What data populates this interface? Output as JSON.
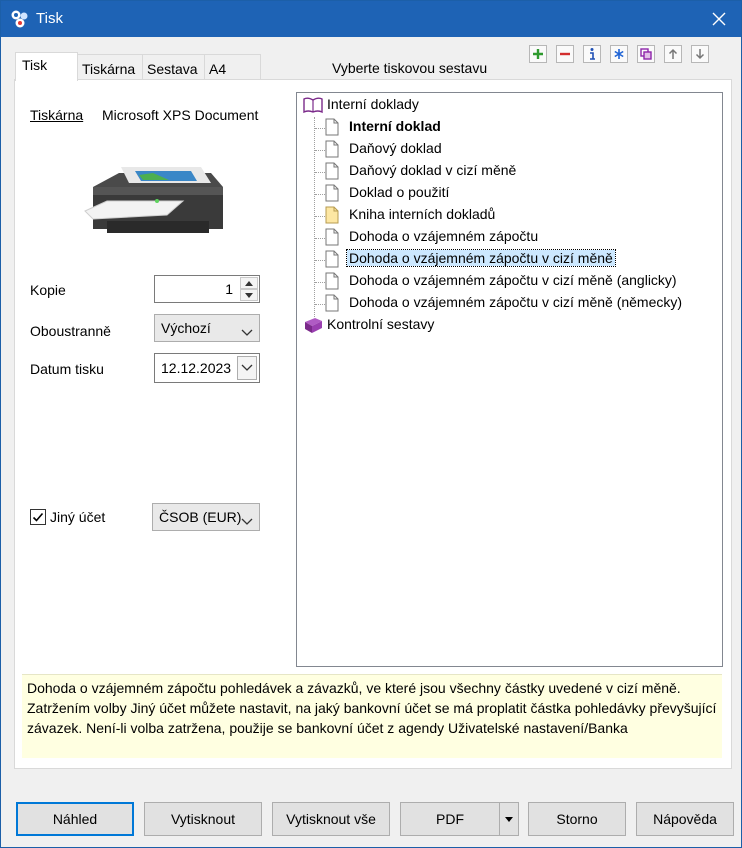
{
  "window": {
    "title": "Tisk"
  },
  "tabs": [
    "Tisk",
    "Tiskárna",
    "Sestava",
    "A4"
  ],
  "toolbar": {
    "label": "Vyberte tiskovou sestavu",
    "icons": [
      "add-icon",
      "remove-icon",
      "info-icon",
      "asterisk-icon",
      "copy-icon",
      "move-up-icon",
      "move-down-icon"
    ]
  },
  "printer": {
    "label": "Tiskárna",
    "name": "Microsoft XPS Document"
  },
  "copies": {
    "label": "Kopie",
    "value": "1"
  },
  "duplex": {
    "label": "Oboustranně",
    "value": "Výchozí"
  },
  "print_date": {
    "label": "Datum tisku",
    "value": "12.12.2023"
  },
  "other_account": {
    "label": "Jiný účet",
    "checked": true,
    "value": "ČSOB (EUR)"
  },
  "tree": {
    "groups": [
      {
        "label": "Interní doklady",
        "items": [
          {
            "label": "Interní doklad",
            "bold": true
          },
          {
            "label": "Daňový doklad"
          },
          {
            "label": "Daňový doklad v cizí měně"
          },
          {
            "label": "Doklad o použití"
          },
          {
            "label": "Kniha interních dokladů",
            "folder": true
          },
          {
            "label": "Dohoda o vzájemném zápočtu"
          },
          {
            "label": "Dohoda o vzájemném zápočtu v cizí měně",
            "selected": true
          },
          {
            "label": "Dohoda o vzájemném zápočtu v cizí měně (anglicky)"
          },
          {
            "label": "Dohoda o vzájemném zápočtu v cizí měně (německy)"
          }
        ]
      },
      {
        "label": "Kontrolní sestavy",
        "items": []
      }
    ]
  },
  "description": "Dohoda o vzájemném zápočtu pohledávek a závazků, ve které jsou všechny částky uvedené v cizí měně. Zatržením volby Jiný účet můžete nastavit, na jaký bankovní účet se má proplatit částka pohledávky převyšující závazek. Není-li volba zatržena, použije se bankovní účet z agendy Uživatelské nastavení/Banka",
  "buttons": {
    "preview": "Náhled",
    "print": "Vytisknout",
    "print_all": "Vytisknout vše",
    "pdf": "PDF",
    "cancel": "Storno",
    "help": "Nápověda"
  },
  "colors": {
    "titlebar": "#1e63b5",
    "selection": "#cce8ff",
    "description_bg": "#ffffe1",
    "focus": "#0078d7"
  }
}
